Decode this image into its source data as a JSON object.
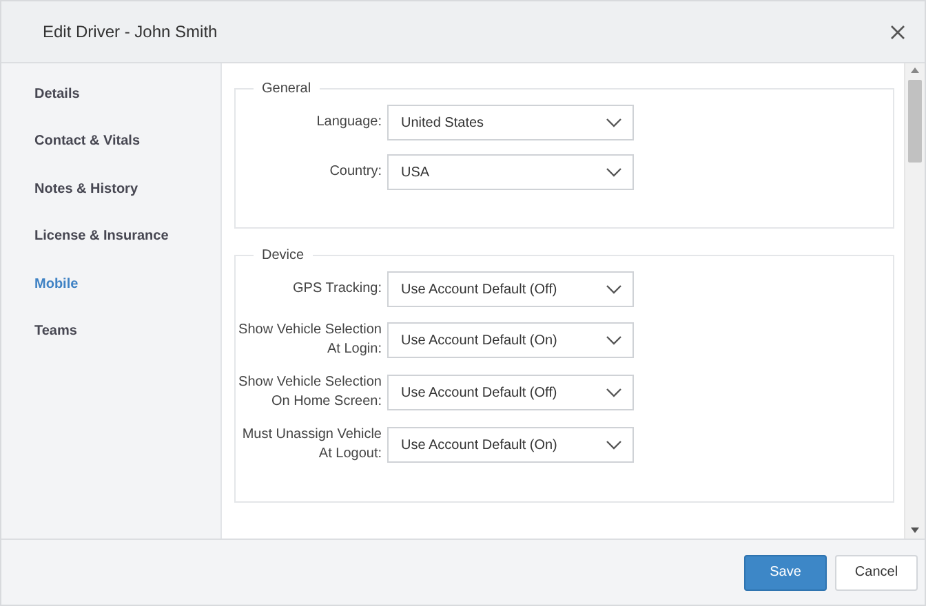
{
  "window": {
    "title": "Edit Driver - John Smith"
  },
  "sidebar": {
    "items": [
      {
        "label": "Details",
        "selected": false
      },
      {
        "label": "Contact & Vitals",
        "selected": false
      },
      {
        "label": "Notes & History",
        "selected": false
      },
      {
        "label": "License & Insurance",
        "selected": false
      },
      {
        "label": "Mobile",
        "selected": true
      },
      {
        "label": "Teams",
        "selected": false
      }
    ]
  },
  "sections": [
    {
      "legend": "General",
      "fields": [
        {
          "label": "Language:",
          "value": "United States"
        },
        {
          "label": "Country:",
          "value": "USA"
        }
      ]
    },
    {
      "legend": "Device",
      "fields": [
        {
          "label": "GPS Tracking:",
          "value": "Use Account Default (Off)"
        },
        {
          "label": "Show Vehicle Selection At Login:",
          "value": "Use Account Default (On)"
        },
        {
          "label": "Show Vehicle Selection On Home Screen:",
          "value": "Use Account Default (Off)"
        },
        {
          "label": "Must Unassign Vehicle At Logout:",
          "value": "Use Account Default (On)"
        }
      ]
    }
  ],
  "buttons": [
    {
      "label": "Save",
      "kind": "primary"
    },
    {
      "label": "Cancel",
      "kind": "secondary"
    }
  ]
}
